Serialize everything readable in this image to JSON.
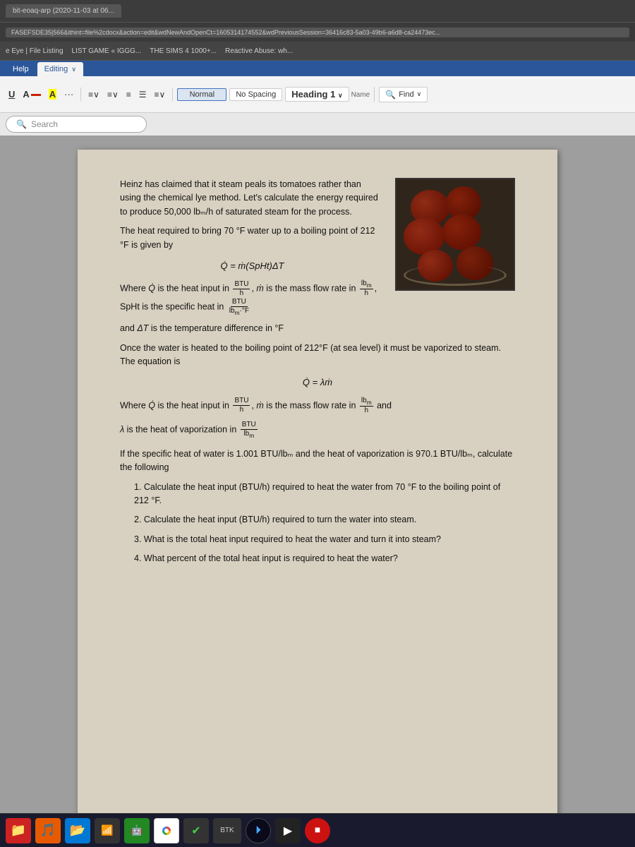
{
  "browser": {
    "tab_text": "bit-eoaq-arp (2020-11-03 at 06...",
    "url": "FASEFSDE35|566&ithint=file%2cdocx&action=edit&wdNewAndOpenCt=1605314174552&wdPreviousSession=36416c83-5a03-49b6-a6d8-ca24473ec...",
    "bookmarks": [
      "e Eye | File Listing",
      "LIST GAME « IGGG...",
      "THE SIMS 4 1000+...",
      "Reactive Abuse: wh..."
    ]
  },
  "ribbon": {
    "tabs": [
      "Help",
      "Editing"
    ],
    "styles": {
      "normal": "Normal",
      "no_spacing": "No Spacing",
      "heading1": "Heading 1"
    },
    "find_label": "Find",
    "name_label": "Name"
  },
  "search": {
    "placeholder": "Search"
  },
  "document": {
    "paragraph1": "Heinz has claimed that it steam peals its tomatoes rather than using the chemical lye method. Let's calculate the energy required to produce 50,000 lbₘ/h of saturated steam for the process.",
    "paragraph2": "The heat required to bring 70 °F water up to a boiling point of 212 °F is given by",
    "formula1": "Q̇ = ṁ(SpHt)ΔT",
    "where1a": "Where Q̇ is the heat input in",
    "where1b": "BTU/h",
    "where1c": ", ṁ is the mass flow rate in",
    "where1d": "lbₘ/h",
    "where1e": ", SpHt is the specific heat in",
    "where1f": "BTU/(lbₘ·°F)",
    "where1g": "and ΔT is the temperature difference in °F",
    "paragraph3": "Once the water is heated to the boiling point of 212°F (at sea level) it must be vaporized to steam. The equation is",
    "formula2": "Q̇ = λṁ",
    "where2a": "Where Q̇ is the heat input in",
    "where2b": "BTU/h",
    "where2c": ", ṁ is the mass flow rate in",
    "where2d": "lbₘ/h",
    "where2e": "and",
    "where2f": "λ is the heat of vaporization in",
    "where2g": "BTU/lbₘ",
    "paragraph4": "If the specific heat of water is 1.001 BTU/lbₘ and the heat of vaporization is 970.1 BTU/lbₘ, calculate the following",
    "list_items": [
      "1.  Calculate the heat input (BTU/h) required to heat the water from 70 °F to the boiling point of 212 °F.",
      "2.  Calculate the heat input (BTU/h) required to turn the water into steam.",
      "3.  What is the total heat input required to heat the water and turn it into steam?",
      "4.  What percent of the total heat input is required to heat the water?"
    ]
  },
  "taskbar": {
    "icons": [
      {
        "name": "file-manager-icon",
        "symbol": "📁",
        "bg": "red-bg"
      },
      {
        "name": "music-icon",
        "symbol": "🎵",
        "bg": "orange-bg"
      },
      {
        "name": "folder-blue-icon",
        "symbol": "📂",
        "bg": "blue-bg"
      },
      {
        "name": "wifi-icon",
        "symbol": "📶",
        "bg": "dark-bg"
      },
      {
        "name": "android-icon",
        "symbol": "🤖",
        "bg": "green-bg"
      },
      {
        "name": "chrome-icon",
        "symbol": "🌐",
        "bg": "chrome"
      },
      {
        "name": "check-icon",
        "symbol": "✔",
        "bg": "dark-bg"
      },
      {
        "name": "center-label",
        "symbol": "BTK",
        "bg": "dark-bg"
      },
      {
        "name": "media-player-icon",
        "symbol": "⏵",
        "bg": "media"
      },
      {
        "name": "play-icon",
        "symbol": "▶",
        "bg": "play-bg"
      },
      {
        "name": "stop-icon",
        "symbol": "⏹",
        "bg": "red2"
      }
    ]
  },
  "colors": {
    "word_blue": "#2b579a",
    "doc_bg": "#d8d0c0",
    "ribbon_bg": "#f3f3f3",
    "taskbar_bg": "#1a1a2e"
  }
}
